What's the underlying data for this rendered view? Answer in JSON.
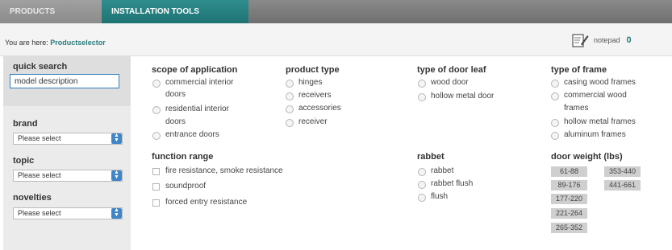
{
  "tabs": [
    {
      "label": "PRODUCTS"
    },
    {
      "label": "INSTALLATION TOOLS"
    }
  ],
  "breadcrumb": {
    "prefix": "You are here:",
    "current": "Productselector"
  },
  "notepad": {
    "label": "notepad",
    "count": "0",
    "icon": "notepad-icon"
  },
  "sidebar": {
    "quick_search": {
      "title": "quick search",
      "value": "model description"
    },
    "brand": {
      "title": "brand",
      "selected": "Please select"
    },
    "topic": {
      "title": "topic",
      "selected": "Please select"
    },
    "novelties": {
      "title": "novelties",
      "selected": "Please select"
    }
  },
  "scope": {
    "title": "scope of application",
    "options": [
      {
        "line1": "commercial interior",
        "line2": "doors"
      },
      {
        "line1": "residential interior",
        "line2": "doors"
      },
      {
        "line1": "entrance doors",
        "line2": ""
      }
    ]
  },
  "product_type": {
    "title": "product type",
    "options": [
      "hinges",
      "receivers",
      "accessories",
      "receiver"
    ]
  },
  "function_range": {
    "title": "function range",
    "options": [
      "fire resistance, smoke resistance",
      "soundproof",
      "forced entry resistance"
    ]
  },
  "door_leaf": {
    "title": "type of door leaf",
    "options": [
      "wood door",
      "hollow metal door"
    ]
  },
  "rabbet": {
    "title": "rabbet",
    "options": [
      "rabbet",
      "rabbet flush",
      "flush"
    ]
  },
  "frame": {
    "title": "type of frame",
    "options": [
      {
        "line1": "casing wood frames",
        "line2": ""
      },
      {
        "line1": "commercial wood",
        "line2": "frames"
      },
      {
        "line1": "hollow metal frames",
        "line2": ""
      },
      {
        "line1": "aluminum frames",
        "line2": ""
      }
    ]
  },
  "door_weight": {
    "title": "door weight (lbs)",
    "ranges": [
      "61-88",
      "353-440",
      "89-176",
      "441-661",
      "177-220",
      "221-264",
      "265-352"
    ]
  }
}
